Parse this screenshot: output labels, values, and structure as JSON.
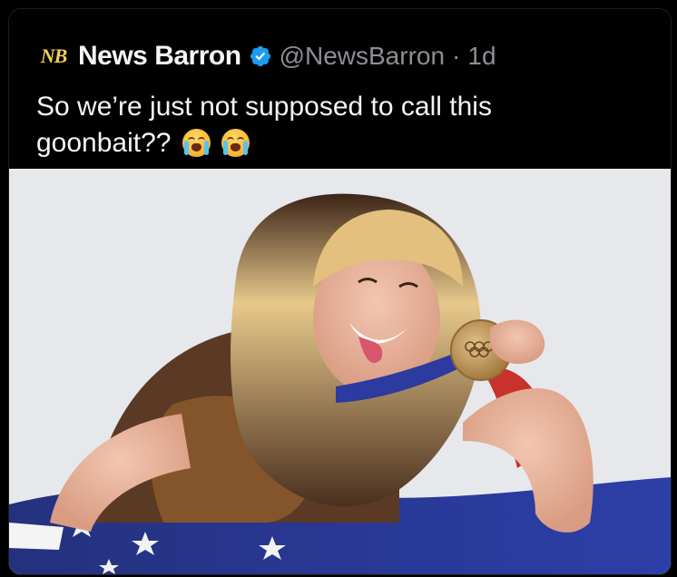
{
  "tweet": {
    "avatar_logo_text": "NB",
    "author_name": "News Barron",
    "handle": "@NewsBarron",
    "separator": "·",
    "timestamp": "1d",
    "text_line1": "So we’re just not supposed to call this",
    "text_line2": "goonbait??",
    "emojis": [
      "loudly-crying-face-icon",
      "loudly-crying-face-icon"
    ],
    "verified_badge_color": "#1d9bf0",
    "media": {
      "description_icon": "photo-icon"
    }
  }
}
